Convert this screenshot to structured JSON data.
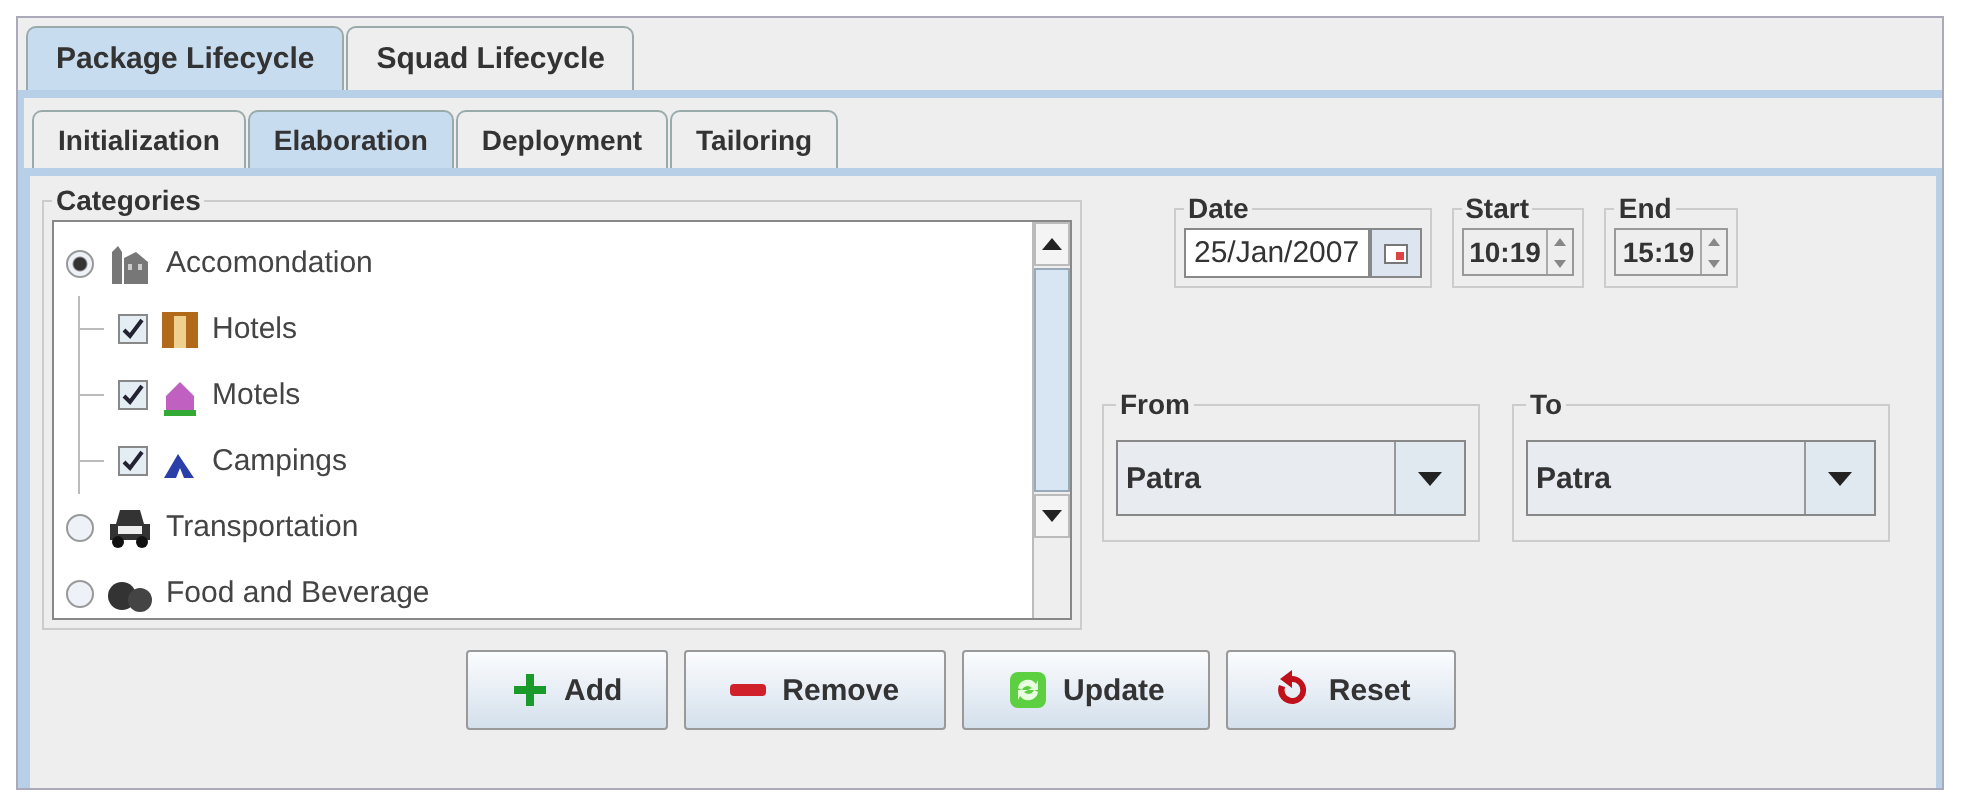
{
  "main_tabs": [
    {
      "label": "Package Lifecycle",
      "selected": true
    },
    {
      "label": "Squad Lifecycle",
      "selected": false
    }
  ],
  "phase_tabs": [
    {
      "label": "Initialization",
      "selected": false
    },
    {
      "label": "Elaboration",
      "selected": true
    },
    {
      "label": "Deployment",
      "selected": false
    },
    {
      "label": "Tailoring",
      "selected": false
    }
  ],
  "categories": {
    "title": "Categories",
    "items": [
      {
        "label": "Accomondation",
        "selected": true,
        "children": [
          {
            "label": "Hotels",
            "checked": true
          },
          {
            "label": "Motels",
            "checked": true
          },
          {
            "label": "Campings",
            "checked": true
          }
        ]
      },
      {
        "label": "Transportation",
        "selected": false
      },
      {
        "label": "Food and Beverage",
        "selected": false
      }
    ]
  },
  "date": {
    "title": "Date",
    "value": "25/Jan/2007"
  },
  "start": {
    "title": "Start",
    "value": "10:19"
  },
  "end": {
    "title": "End",
    "value": "15:19"
  },
  "from": {
    "title": "From",
    "value": "Patra"
  },
  "to": {
    "title": "To",
    "value": "Patra"
  },
  "buttons": [
    {
      "label": "Add",
      "kind": "add"
    },
    {
      "label": "Remove",
      "kind": "remove"
    },
    {
      "label": "Update",
      "kind": "update"
    },
    {
      "label": "Reset",
      "kind": "reset"
    }
  ]
}
